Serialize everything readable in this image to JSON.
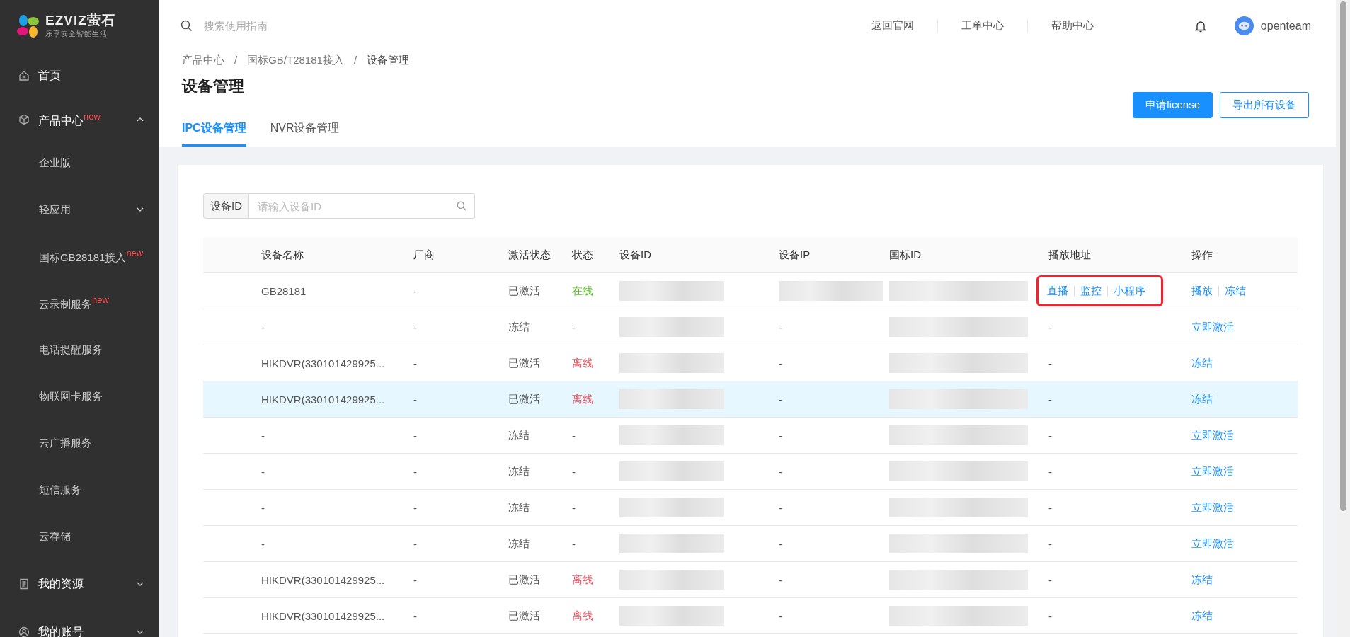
{
  "logo": {
    "brand": "EZVIZ萤石",
    "slogan": "乐享安全智能生活"
  },
  "sidebar": {
    "items": [
      {
        "label": "首页"
      },
      {
        "label": "产品中心",
        "badge": "new",
        "expanded": true,
        "children": [
          {
            "label": "企业版"
          },
          {
            "label": "轻应用",
            "expandable": true
          },
          {
            "label": "国标GB28181接入",
            "badge": "new"
          },
          {
            "label": "云录制服务",
            "badge": "new"
          },
          {
            "label": "电话提醒服务"
          },
          {
            "label": "物联网卡服务"
          },
          {
            "label": "云广播服务"
          },
          {
            "label": "短信服务"
          },
          {
            "label": "云存储"
          }
        ]
      },
      {
        "label": "我的资源",
        "expanded": false
      },
      {
        "label": "我的账号",
        "expanded": false
      }
    ]
  },
  "header": {
    "search": {
      "placeholder": "搜索使用指南"
    },
    "links": [
      "返回官网",
      "工单中心",
      "帮助中心"
    ],
    "user": "openteam"
  },
  "breadcrumb": [
    "产品中心",
    "/",
    "国标GB/T28181接入",
    "/",
    "设备管理"
  ],
  "page_title": "设备管理",
  "buttons": [
    {
      "label": "申请license",
      "kind": "primary"
    },
    {
      "label": "导出所有设备",
      "kind": "outline"
    }
  ],
  "tabs": [
    {
      "label": "IPC设备管理",
      "selected": true
    },
    {
      "label": "NVR设备管理",
      "selected": false
    }
  ],
  "filter": {
    "label": "设备ID",
    "placeholder": "请输入设备ID"
  },
  "table": {
    "columns": [
      "设备名称",
      "厂商",
      "激活状态",
      "状态",
      "设备ID",
      "设备IP",
      "国标ID",
      "播放地址",
      "操作"
    ],
    "rows": [
      {
        "name": "GB28181",
        "vendor": "-",
        "activation": "已激活",
        "status": "在线",
        "color": "#52c41a",
        "ip_redacted": true,
        "play_links": [
          "直播",
          "监控",
          "小程序"
        ],
        "play_annotated": true,
        "actions": [
          "播放",
          "冻结"
        ],
        "selected": false
      },
      {
        "name": "-",
        "vendor": "-",
        "activation": "冻结",
        "status": "-",
        "color": "#555555",
        "device_ip": "-",
        "play_text": "-",
        "play_annotated": false,
        "actions": [
          "立即激活"
        ],
        "selected": false
      },
      {
        "name": "HIKDVR(330101429925...",
        "vendor": "-",
        "activation": "已激活",
        "status": "离线",
        "color": "#f5515f",
        "device_ip": "-",
        "play_text": "-",
        "play_annotated": false,
        "actions": [
          "冻结"
        ],
        "selected": false
      },
      {
        "name": "HIKDVR(330101429925...",
        "vendor": "-",
        "activation": "已激活",
        "status": "离线",
        "color": "#f5515f",
        "device_ip": "-",
        "play_text": "-",
        "play_annotated": false,
        "actions": [
          "冻结"
        ],
        "selected": true
      },
      {
        "name": "-",
        "vendor": "-",
        "activation": "冻结",
        "status": "-",
        "color": "#555555",
        "device_ip": "-",
        "play_text": "-",
        "play_annotated": false,
        "actions": [
          "立即激活"
        ],
        "selected": false
      },
      {
        "name": "-",
        "vendor": "-",
        "activation": "冻结",
        "status": "-",
        "color": "#555555",
        "device_ip": "-",
        "play_text": "-",
        "play_annotated": false,
        "actions": [
          "立即激活"
        ],
        "selected": false
      },
      {
        "name": "-",
        "vendor": "-",
        "activation": "冻结",
        "status": "-",
        "color": "#555555",
        "device_ip": "-",
        "play_text": "-",
        "play_annotated": false,
        "actions": [
          "立即激活"
        ],
        "selected": false
      },
      {
        "name": "-",
        "vendor": "-",
        "activation": "冻结",
        "status": "-",
        "color": "#555555",
        "device_ip": "-",
        "play_text": "-",
        "play_annotated": false,
        "actions": [
          "立即激活"
        ],
        "selected": false
      },
      {
        "name": "HIKDVR(330101429925...",
        "vendor": "-",
        "activation": "已激活",
        "status": "离线",
        "color": "#f5515f",
        "device_ip": "-",
        "play_text": "-",
        "play_annotated": false,
        "actions": [
          "冻结"
        ],
        "selected": false
      },
      {
        "name": "HIKDVR(330101429925...",
        "vendor": "-",
        "activation": "已激活",
        "status": "离线",
        "color": "#f5515f",
        "device_ip": "-",
        "play_text": "-",
        "play_annotated": false,
        "actions": [
          "冻结"
        ],
        "selected": false
      }
    ]
  }
}
